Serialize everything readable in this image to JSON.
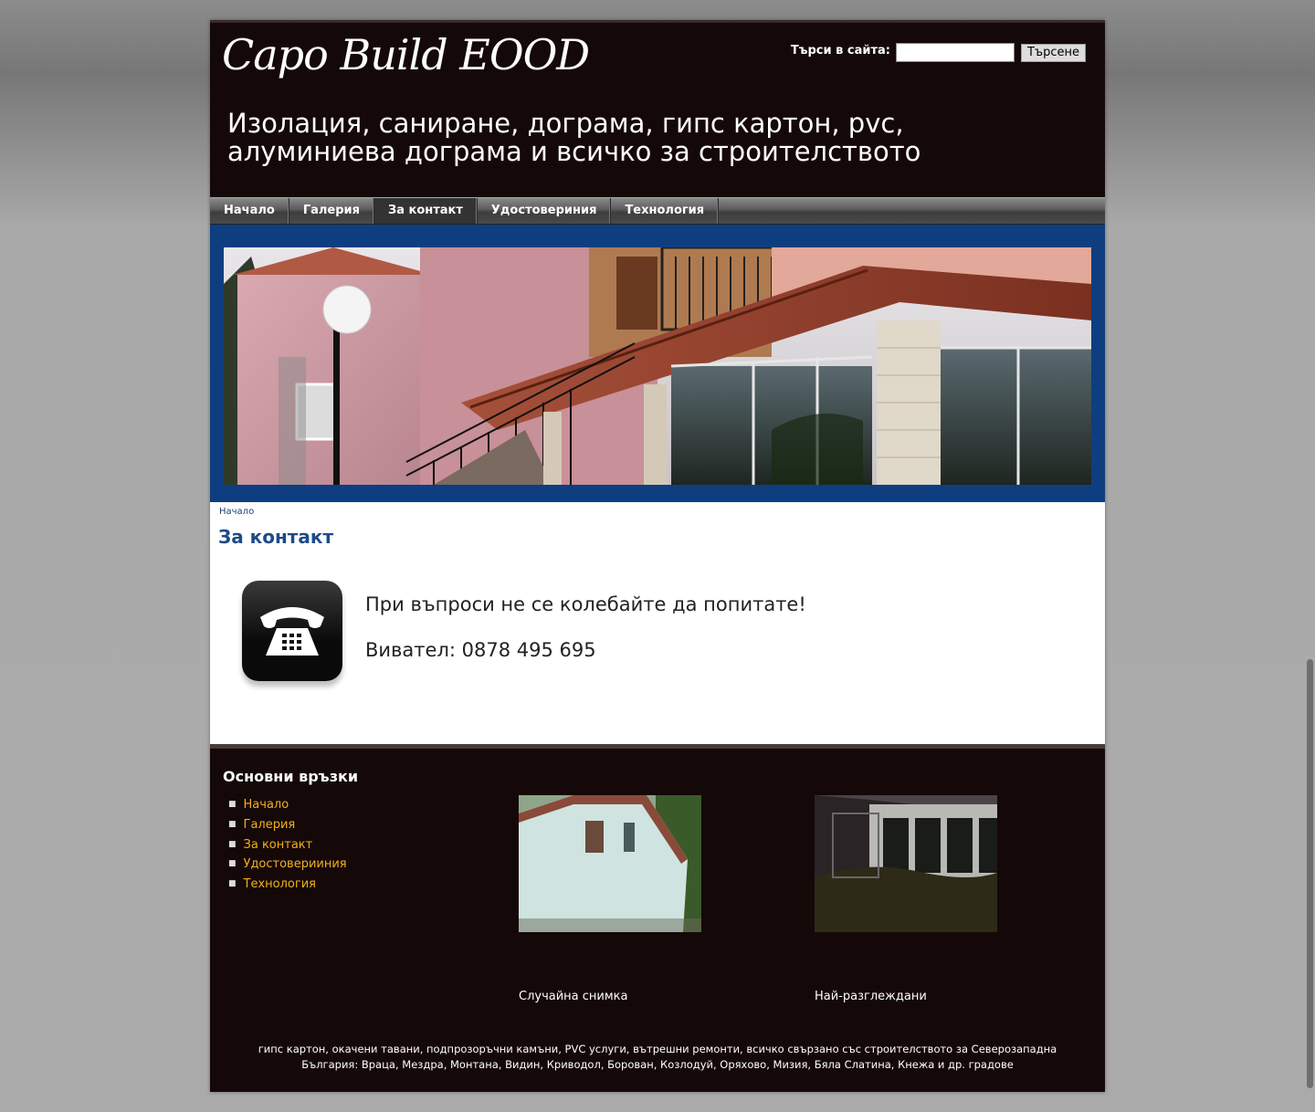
{
  "header": {
    "logo": "Capo Build  EOOD",
    "search_label": "Търси в сайта:",
    "search_value": "",
    "search_button": "Търсене",
    "slogan": "Изолация, саниране, дограма, гипс картон, pvc, алуминиева дограма и всичко за строителството"
  },
  "nav": {
    "items": [
      {
        "label": "Начало"
      },
      {
        "label": "Галерия"
      },
      {
        "label": "За контакт",
        "active": true
      },
      {
        "label": "Удостовериния"
      },
      {
        "label": "Технология"
      }
    ]
  },
  "breadcrumb": "Начало",
  "page_title": "За контакт",
  "contact": {
    "line1": "При въпроси не се колебайте да попитате!",
    "line2": "Виватeл: 0878 495 695"
  },
  "footer": {
    "heading": "Основни връзки",
    "links": [
      "Начало",
      "Галерия",
      "За контакт",
      "Удостоверииния",
      "Технология"
    ],
    "random_photo_caption": "Случайна снимка",
    "most_viewed_caption": "Най-разглеждани",
    "seo_text": "гипс картон, окачени тавани, подпрозоръчни камъни, PVC услуги, вътрешни ремонти, всичко свързано със строителството за Северозападна България: Враца, Мездра, Монтана, Видин, Криводол, Борован, Козлодуй, Оряхово, Мизия, Бяла Слатина, Кнежа и др. градове"
  },
  "colors": {
    "header_bg": "#150808",
    "banner_frame": "#0e3e80",
    "title_blue": "#1e4a86",
    "footer_link": "#f2b01e"
  }
}
